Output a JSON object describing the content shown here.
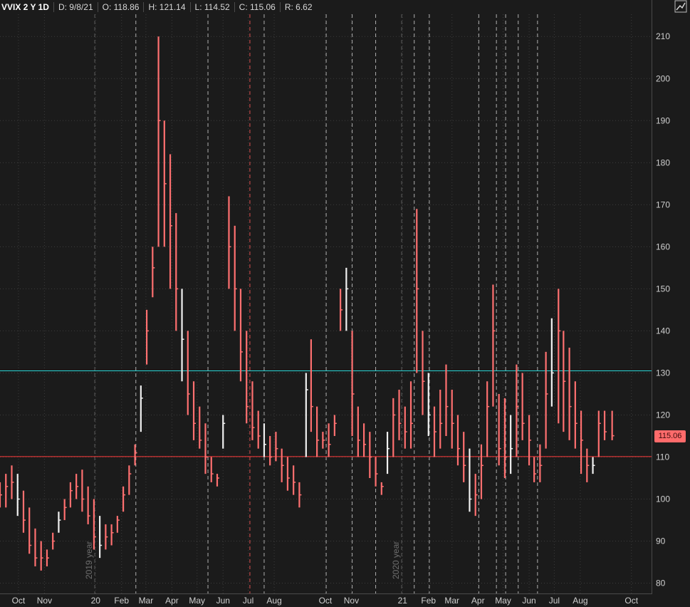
{
  "header": {
    "symbol": "VVIX 2 Y 1D",
    "date": "D: 9/8/21",
    "open": "O: 118.86",
    "high": "H: 121.14",
    "low": "L: 114.52",
    "close": "C: 115.06",
    "range": "R: 6.62"
  },
  "price_tag": "115.06",
  "colors": {
    "background": "#1b1b1b",
    "candle": "#ff7070",
    "candle_alt": "#f0f0f0",
    "support_line": "#ff3b3b",
    "resistance_line": "#2ad4d4",
    "vline": "#c8c8c8",
    "vline_red": "#ff5a5a",
    "grid": "#3c3c3c"
  },
  "icons": [
    "draw-tool-icon"
  ],
  "chart_data": {
    "type": "line",
    "title": "",
    "xlabel": "",
    "ylabel": "",
    "ylim": [
      80,
      212
    ],
    "y_ticks": [
      80,
      90,
      100,
      110,
      120,
      130,
      140,
      150,
      160,
      170,
      180,
      190,
      200,
      210
    ],
    "x_ticks": [
      {
        "label": "Oct",
        "date": "2019-10-01"
      },
      {
        "label": "Nov",
        "date": "2019-11-01"
      },
      {
        "label": "20",
        "date": "2020-01-01"
      },
      {
        "label": "Feb",
        "date": "2020-02-01"
      },
      {
        "label": "Mar",
        "date": "2020-03-01"
      },
      {
        "label": "Apr",
        "date": "2020-04-01"
      },
      {
        "label": "May",
        "date": "2020-05-01"
      },
      {
        "label": "Jun",
        "date": "2020-06-01"
      },
      {
        "label": "Jul",
        "date": "2020-07-01"
      },
      {
        "label": "Aug",
        "date": "2020-08-01"
      },
      {
        "label": "Oct",
        "date": "2020-10-01"
      },
      {
        "label": "Nov",
        "date": "2020-11-01"
      },
      {
        "label": "21",
        "date": "2021-01-01"
      },
      {
        "label": "Feb",
        "date": "2021-02-01"
      },
      {
        "label": "Mar",
        "date": "2021-03-01"
      },
      {
        "label": "Apr",
        "date": "2021-04-01"
      },
      {
        "label": "May",
        "date": "2021-05-01"
      },
      {
        "label": "Jun",
        "date": "2021-06-01"
      },
      {
        "label": "Jul",
        "date": "2021-07-01"
      },
      {
        "label": "Aug",
        "date": "2021-08-01"
      },
      {
        "label": "Oct",
        "date": "2021-10-01"
      }
    ],
    "year_labels": [
      {
        "label": "2019 year",
        "date": "2019-12-31"
      },
      {
        "label": "2020 year",
        "date": "2020-12-31"
      }
    ],
    "horizontal_lines": [
      {
        "value": 130.5,
        "color": "#2ad4d4"
      },
      {
        "value": 110.1,
        "color": "#ff3b3b"
      }
    ],
    "vertical_lines": [
      {
        "date": "2019-12-31",
        "style": "dashed",
        "color": "gray"
      },
      {
        "date": "2020-02-18",
        "style": "dashed",
        "color": "white"
      },
      {
        "date": "2020-05-14",
        "style": "dashed",
        "color": "white"
      },
      {
        "date": "2020-07-03",
        "style": "dashed",
        "color": "red"
      },
      {
        "date": "2020-07-20",
        "style": "dashed",
        "color": "white"
      },
      {
        "date": "2020-10-02",
        "style": "dashed",
        "color": "white"
      },
      {
        "date": "2020-11-02",
        "style": "dashed",
        "color": "white"
      },
      {
        "date": "2020-11-30",
        "style": "dashed",
        "color": "white"
      },
      {
        "date": "2020-12-31",
        "style": "dashed",
        "color": "gray"
      },
      {
        "date": "2021-01-15",
        "style": "dashed",
        "color": "white"
      },
      {
        "date": "2021-02-02",
        "style": "dashed",
        "color": "white"
      },
      {
        "date": "2021-04-02",
        "style": "dashed",
        "color": "white"
      },
      {
        "date": "2021-04-23",
        "style": "dashed",
        "color": "white"
      },
      {
        "date": "2021-05-04",
        "style": "dashed",
        "color": "white"
      },
      {
        "date": "2021-05-19",
        "style": "dashed",
        "color": "white"
      },
      {
        "date": "2021-06-11",
        "style": "dashed",
        "color": "white"
      }
    ],
    "series": [
      {
        "x": [
          "2019-09-09",
          "2019-09-16",
          "2019-09-23",
          "2019-09-30",
          "2019-10-07",
          "2019-10-14",
          "2019-10-21",
          "2019-10-28",
          "2019-11-04",
          "2019-11-11",
          "2019-11-18",
          "2019-11-25",
          "2019-12-02",
          "2019-12-09",
          "2019-12-16",
          "2019-12-23",
          "2019-12-30",
          "2020-01-06",
          "2020-01-13",
          "2020-01-20",
          "2020-01-27",
          "2020-02-03",
          "2020-02-10",
          "2020-02-17",
          "2020-02-24",
          "2020-03-02",
          "2020-03-09",
          "2020-03-16",
          "2020-03-23",
          "2020-03-30",
          "2020-04-06",
          "2020-04-13",
          "2020-04-20",
          "2020-04-27",
          "2020-05-04",
          "2020-05-11",
          "2020-05-18",
          "2020-05-25",
          "2020-06-01",
          "2020-06-08",
          "2020-06-15",
          "2020-06-22",
          "2020-06-29",
          "2020-07-06",
          "2020-07-13",
          "2020-07-20",
          "2020-07-27",
          "2020-08-03",
          "2020-08-10",
          "2020-08-17",
          "2020-08-24",
          "2020-08-31",
          "2020-09-08",
          "2020-09-14",
          "2020-09-21",
          "2020-09-28",
          "2020-10-05",
          "2020-10-12",
          "2020-10-19",
          "2020-10-26",
          "2020-11-02",
          "2020-11-09",
          "2020-11-16",
          "2020-11-23",
          "2020-11-30",
          "2020-12-07",
          "2020-12-14",
          "2020-12-21",
          "2020-12-28",
          "2021-01-04",
          "2021-01-11",
          "2021-01-18",
          "2021-01-25",
          "2021-02-01",
          "2021-02-08",
          "2021-02-15",
          "2021-02-22",
          "2021-03-01",
          "2021-03-08",
          "2021-03-15",
          "2021-03-22",
          "2021-03-29",
          "2021-04-05",
          "2021-04-12",
          "2021-04-19",
          "2021-04-26",
          "2021-05-03",
          "2021-05-10",
          "2021-05-17",
          "2021-05-24",
          "2021-06-01",
          "2021-06-07",
          "2021-06-14",
          "2021-06-21",
          "2021-06-28",
          "2021-07-06",
          "2021-07-12",
          "2021-07-19",
          "2021-07-26",
          "2021-08-02",
          "2021-08-09",
          "2021-08-16",
          "2021-08-23",
          "2021-08-30",
          "2021-09-08"
        ],
        "high": [
          104,
          106,
          108,
          106,
          102,
          98,
          93,
          90,
          88,
          92,
          97,
          100,
          104,
          106,
          107,
          103,
          100,
          96,
          94,
          94,
          96,
          103,
          108,
          113,
          127,
          145,
          160,
          210,
          190,
          182,
          168,
          150,
          140,
          128,
          122,
          118,
          110,
          106,
          120,
          172,
          165,
          150,
          140,
          128,
          121,
          118,
          115,
          116,
          112,
          110,
          108,
          104,
          130,
          138,
          122,
          116,
          118,
          120,
          150,
          155,
          140,
          122,
          118,
          116,
          110,
          104,
          116,
          124,
          126,
          122,
          128,
          169,
          140,
          130,
          122,
          126,
          132,
          126,
          120,
          116,
          112,
          106,
          113,
          128,
          151,
          125,
          124,
          120,
          132,
          130,
          120,
          110,
          113,
          135,
          143,
          150,
          140,
          136,
          128,
          121,
          112,
          110,
          121,
          121,
          121
        ],
        "low": [
          98,
          98,
          100,
          96,
          92,
          87,
          84,
          83,
          84,
          88,
          92,
          95,
          98,
          100,
          97,
          94,
          88,
          86,
          88,
          89,
          92,
          97,
          101,
          108,
          116,
          132,
          148,
          160,
          160,
          150,
          140,
          128,
          120,
          114,
          112,
          106,
          104,
          103,
          112,
          150,
          140,
          128,
          118,
          114,
          112,
          110,
          108,
          109,
          104,
          102,
          101,
          98,
          110,
          116,
          110,
          112,
          110,
          115,
          140,
          140,
          115,
          110,
          110,
          105,
          103,
          101,
          106,
          110,
          114,
          112,
          112,
          130,
          120,
          115,
          110,
          112,
          115,
          112,
          108,
          104,
          97,
          96,
          100,
          110,
          122,
          108,
          105,
          106,
          110,
          114,
          108,
          104,
          104,
          112,
          122,
          118,
          116,
          114,
          112,
          106,
          104,
          106,
          110,
          114,
          114
        ],
        "close": [
          101,
          103,
          104,
          100,
          95,
          89,
          86,
          86,
          86,
          90,
          95,
          98,
          102,
          103,
          100,
          96,
          91,
          89,
          91,
          92,
          95,
          101,
          106,
          111,
          124,
          140,
          155,
          190,
          175,
          165,
          150,
          138,
          125,
          118,
          114,
          110,
          106,
          105,
          118,
          160,
          150,
          135,
          122,
          117,
          115,
          113,
          110,
          112,
          108,
          105,
          104,
          101,
          126,
          122,
          114,
          114,
          113,
          118,
          145,
          150,
          125,
          114,
          113,
          110,
          106,
          103,
          112,
          120,
          118,
          116,
          118,
          150,
          128,
          120,
          116,
          118,
          122,
          118,
          112,
          108,
          100,
          101,
          108,
          122,
          140,
          112,
          110,
          112,
          122,
          118,
          114,
          106,
          108,
          125,
          130,
          140,
          128,
          122,
          118,
          114,
          108,
          108,
          118,
          116,
          115.06
        ]
      }
    ]
  }
}
